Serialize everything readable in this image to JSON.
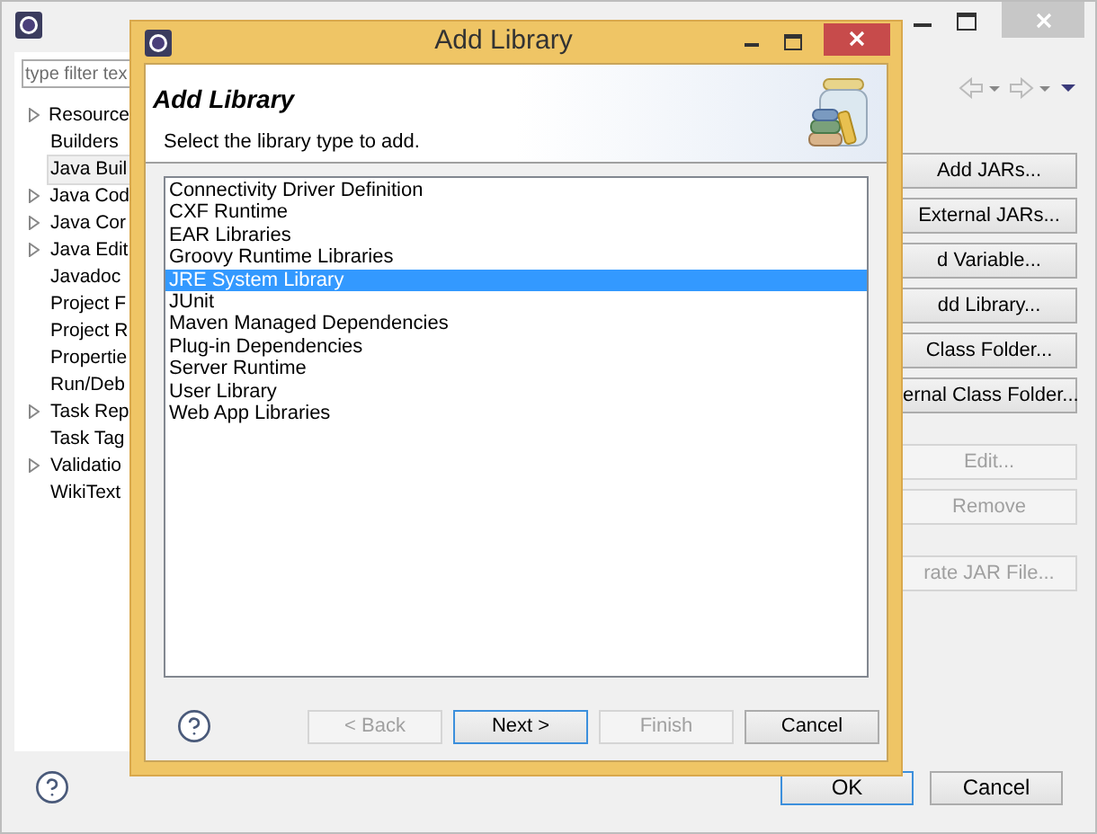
{
  "window": {
    "filter": {
      "placeholder": "type filter tex"
    },
    "tree": [
      {
        "label": "Resource",
        "expandable": true,
        "selected": false
      },
      {
        "label": "Builders",
        "expandable": false,
        "selected": false
      },
      {
        "label": "Java Buil",
        "expandable": false,
        "selected": true
      },
      {
        "label": "Java Cod",
        "expandable": true,
        "selected": false
      },
      {
        "label": "Java Cor",
        "expandable": true,
        "selected": false
      },
      {
        "label": "Java Edit",
        "expandable": true,
        "selected": false
      },
      {
        "label": "Javadoc",
        "expandable": false,
        "selected": false
      },
      {
        "label": "Project F",
        "expandable": false,
        "selected": false
      },
      {
        "label": "Project R",
        "expandable": false,
        "selected": false
      },
      {
        "label": "Propertie",
        "expandable": false,
        "selected": false
      },
      {
        "label": "Run/Deb",
        "expandable": false,
        "selected": false
      },
      {
        "label": "Task Rep",
        "expandable": true,
        "selected": false
      },
      {
        "label": "Task Tag",
        "expandable": false,
        "selected": false
      },
      {
        "label": "Validatio",
        "expandable": true,
        "selected": false
      },
      {
        "label": "WikiText",
        "expandable": false,
        "selected": false
      }
    ],
    "side_button_groups": [
      [
        {
          "label": "Add JARs...",
          "disabled": false
        },
        {
          "label": "External JARs...",
          "disabled": false
        },
        {
          "label": "d Variable...",
          "disabled": false
        },
        {
          "label": "dd Library...",
          "disabled": false
        },
        {
          "label": "Class Folder...",
          "disabled": false
        },
        {
          "label": "ernal Class Folder...",
          "disabled": false
        }
      ],
      [
        {
          "label": "Edit...",
          "disabled": true
        },
        {
          "label": "Remove",
          "disabled": true
        }
      ],
      [
        {
          "label": "rate JAR File...",
          "disabled": true
        }
      ]
    ],
    "buttons": [
      {
        "label": "OK",
        "default": true
      },
      {
        "label": "Cancel",
        "default": false
      }
    ]
  },
  "dialog": {
    "title": "Add Library",
    "heading": "Add Library",
    "description": "Select the library type to add.",
    "libraries": [
      {
        "label": "Connectivity Driver Definition",
        "selected": false
      },
      {
        "label": "CXF Runtime",
        "selected": false
      },
      {
        "label": "EAR Libraries",
        "selected": false
      },
      {
        "label": "Groovy Runtime Libraries",
        "selected": false
      },
      {
        "label": "JRE System Library",
        "selected": true
      },
      {
        "label": "JUnit",
        "selected": false
      },
      {
        "label": "Maven Managed Dependencies",
        "selected": false
      },
      {
        "label": "Plug-in Dependencies",
        "selected": false
      },
      {
        "label": "Server Runtime",
        "selected": false
      },
      {
        "label": "User Library",
        "selected": false
      },
      {
        "label": "Web App Libraries",
        "selected": false
      }
    ],
    "buttons": [
      {
        "label": "< Back",
        "disabled": true,
        "default": false
      },
      {
        "label": "Next >",
        "disabled": false,
        "default": true
      },
      {
        "label": "Finish",
        "disabled": true,
        "default": false
      },
      {
        "label": "Cancel",
        "disabled": false,
        "default": false
      }
    ]
  }
}
